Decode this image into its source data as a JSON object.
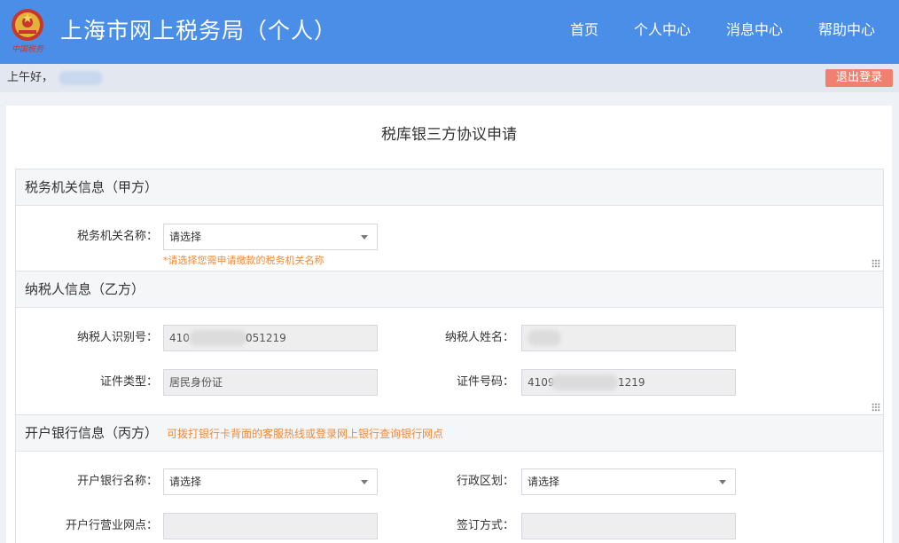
{
  "header": {
    "site_title": "上海市网上税务局（个人）",
    "nav": [
      "首页",
      "个人中心",
      "消息中心",
      "帮助中心"
    ],
    "brand_color": "#4a8ee8"
  },
  "greeting": {
    "text": "上午好，",
    "logout_label": "退出登录",
    "logout_color": "#f0806f"
  },
  "form": {
    "title": "税库银三方协议申请",
    "sections": {
      "tax_authority": {
        "title": "税务机关信息（甲方）",
        "authority_name_label": "税务机关名称：",
        "authority_name_value": "请选择",
        "authority_name_hint": "*请选择您需申请缴款的税务机关名称"
      },
      "taxpayer": {
        "title": "纳税人信息（乙方）",
        "id_label": "纳税人识别号：",
        "id_value_prefix": "410",
        "id_value_suffix": "051219",
        "name_label": "纳税人姓名：",
        "cert_type_label": "证件类型：",
        "cert_type_value": "居民身份证",
        "cert_no_label": "证件号码：",
        "cert_no_prefix": "4109",
        "cert_no_suffix": "1219"
      },
      "bank": {
        "title": "开户银行信息（丙方）",
        "hint": "可拨打银行卡背面的客服热线或登录网上银行查询银行网点",
        "bank_name_label": "开户银行名称：",
        "bank_name_value": "请选择",
        "region_label": "行政区划：",
        "region_value": "请选择",
        "branch_label": "开户行营业网点：",
        "sign_method_label": "签订方式："
      }
    }
  },
  "hint_color": "#f08a3a"
}
